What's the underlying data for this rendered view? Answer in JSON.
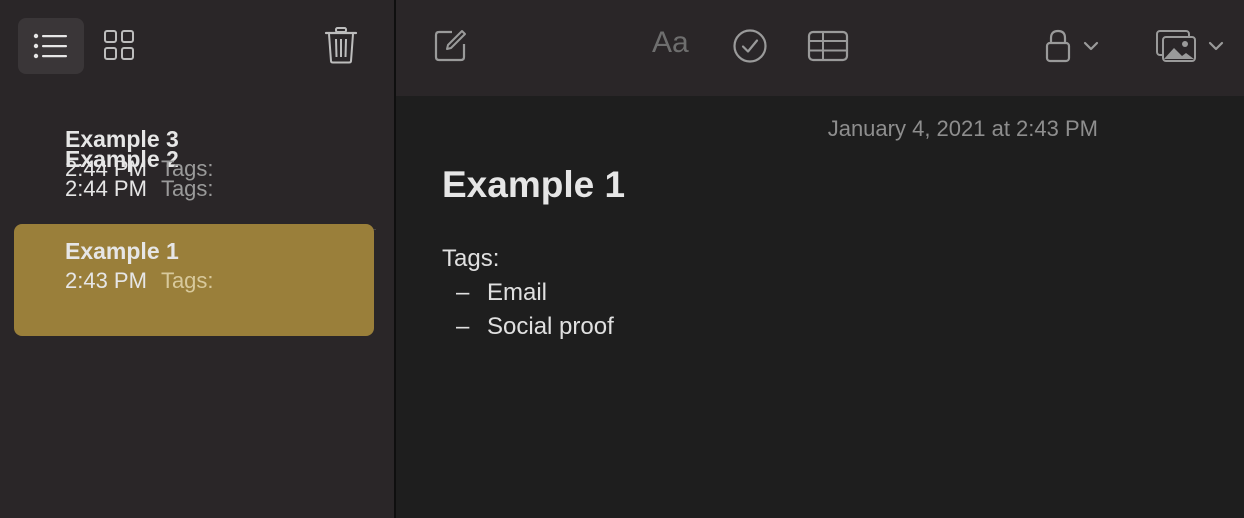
{
  "sidebar": {
    "notes": [
      {
        "title": "Example 2",
        "time": "2:44 PM",
        "tags": "Tags:"
      },
      {
        "title": "Example 3",
        "time": "2:44 PM",
        "tags": "Tags:"
      },
      {
        "title": "Example 1",
        "time": "2:43 PM",
        "tags": "Tags:"
      }
    ],
    "selected_index": 2
  },
  "toolbar": {
    "format_label": "Aa"
  },
  "note": {
    "date": "January 4, 2021 at 2:43 PM",
    "title": "Example 1",
    "tags_label": "Tags:",
    "dash": "–",
    "tag_items": [
      "Email",
      "Social proof"
    ]
  },
  "colors": {
    "selection": "#9a7f3a",
    "sidebar_bg": "#2a2628",
    "editor_bg": "#1e1e1e"
  },
  "icons": [
    "list-view-icon",
    "grid-view-icon",
    "trash-icon",
    "compose-icon",
    "checklist-icon",
    "table-icon",
    "lock-icon",
    "media-icon"
  ]
}
